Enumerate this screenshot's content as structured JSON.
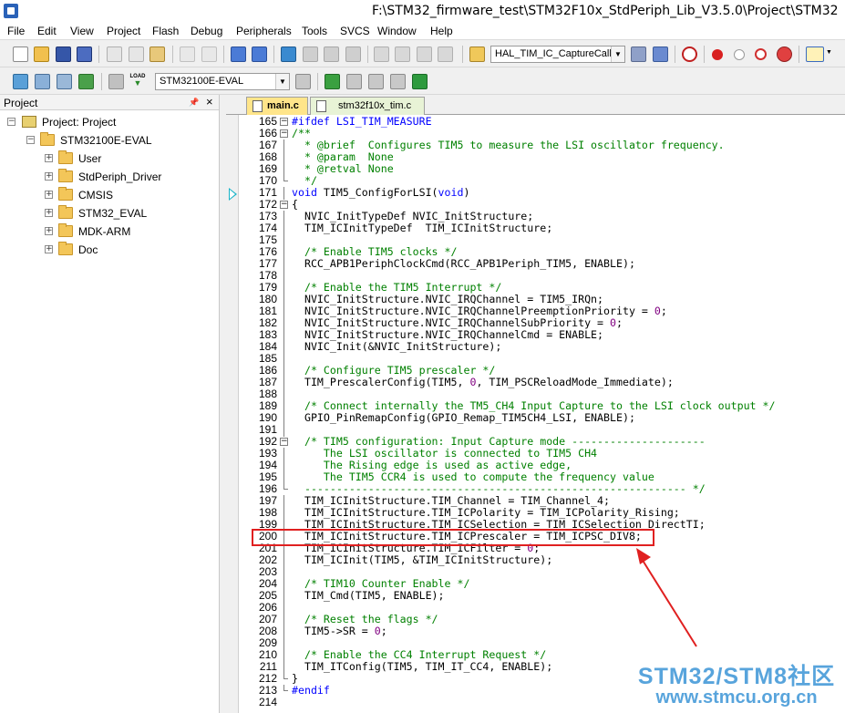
{
  "window": {
    "title": "F:\\STM32_firmware_test\\STM32F10x_StdPeriph_Lib_V3.5.0\\Project\\STM32"
  },
  "menu": [
    "File",
    "Edit",
    "View",
    "Project",
    "Flash",
    "Debug",
    "Peripherals",
    "Tools",
    "SVCS",
    "Window",
    "Help"
  ],
  "toolbar": {
    "function_combo": "HAL_TIM_IC_CaptureCallb",
    "target_combo": "STM32100E-EVAL",
    "load_label": "LOAD"
  },
  "project_panel": {
    "title": "Project",
    "pin_icon": "pin-icon",
    "close_label": "×",
    "root": "Project: Project",
    "target": "STM32100E-EVAL",
    "groups": [
      "User",
      "StdPeriph_Driver",
      "CMSIS",
      "STM32_EVAL",
      "MDK-ARM",
      "Doc"
    ]
  },
  "tabs": [
    {
      "label": "main.c",
      "active": true
    },
    {
      "label": "stm32f10x_tim.c",
      "active": false
    }
  ],
  "highlighted_line": 200,
  "code": [
    {
      "n": "165",
      "t": "#ifdef LSI_TIM_MEASURE",
      "k": "preproc",
      "f": "box"
    },
    {
      "n": "166",
      "t": "/**",
      "k": "comment",
      "f": "box"
    },
    {
      "n": "167",
      "t": "  * @brief  Configures TIM5 to measure the LSI oscillator frequency.",
      "k": "comment",
      "f": "line"
    },
    {
      "n": "168",
      "t": "  * @param  None",
      "k": "comment",
      "f": "line"
    },
    {
      "n": "169",
      "t": "  * @retval None",
      "k": "comment",
      "f": "line"
    },
    {
      "n": "170",
      "t": "  */",
      "k": "comment",
      "f": "end"
    },
    {
      "n": "171",
      "t": "void TIM5_ConfigForLSI(void)",
      "k": "code",
      "f": "line"
    },
    {
      "n": "172",
      "t": "{",
      "k": "code",
      "f": "box"
    },
    {
      "n": "173",
      "t": "  NVIC_InitTypeDef NVIC_InitStructure;",
      "k": "code",
      "f": "line"
    },
    {
      "n": "174",
      "t": "  TIM_ICInitTypeDef  TIM_ICInitStructure;",
      "k": "code",
      "f": "line"
    },
    {
      "n": "175",
      "t": "",
      "k": "code",
      "f": "line"
    },
    {
      "n": "176",
      "t": "  /* Enable TIM5 clocks */",
      "k": "comment",
      "f": "line"
    },
    {
      "n": "177",
      "t": "  RCC_APB1PeriphClockCmd(RCC_APB1Periph_TIM5, ENABLE);",
      "k": "code",
      "f": "line"
    },
    {
      "n": "178",
      "t": "",
      "k": "code",
      "f": "line"
    },
    {
      "n": "179",
      "t": "  /* Enable the TIM5 Interrupt */",
      "k": "comment",
      "f": "line"
    },
    {
      "n": "180",
      "t": "  NVIC_InitStructure.NVIC_IRQChannel = TIM5_IRQn;",
      "k": "code",
      "f": "line"
    },
    {
      "n": "181",
      "t": "  NVIC_InitStructure.NVIC_IRQChannelPreemptionPriority = 0;",
      "k": "code",
      "f": "line"
    },
    {
      "n": "182",
      "t": "  NVIC_InitStructure.NVIC_IRQChannelSubPriority = 0;",
      "k": "code",
      "f": "line"
    },
    {
      "n": "183",
      "t": "  NVIC_InitStructure.NVIC_IRQChannelCmd = ENABLE;",
      "k": "code",
      "f": "line"
    },
    {
      "n": "184",
      "t": "  NVIC_Init(&NVIC_InitStructure);",
      "k": "code",
      "f": "line"
    },
    {
      "n": "185",
      "t": "",
      "k": "code",
      "f": "line"
    },
    {
      "n": "186",
      "t": "  /* Configure TIM5 prescaler */",
      "k": "comment",
      "f": "line"
    },
    {
      "n": "187",
      "t": "  TIM_PrescalerConfig(TIM5, 0, TIM_PSCReloadMode_Immediate);",
      "k": "code",
      "f": "line"
    },
    {
      "n": "188",
      "t": "",
      "k": "code",
      "f": "line"
    },
    {
      "n": "189",
      "t": "  /* Connect internally the TM5_CH4 Input Capture to the LSI clock output */",
      "k": "comment",
      "f": "line"
    },
    {
      "n": "190",
      "t": "  GPIO_PinRemapConfig(GPIO_Remap_TIM5CH4_LSI, ENABLE);",
      "k": "code",
      "f": "line"
    },
    {
      "n": "191",
      "t": "",
      "k": "code",
      "f": "line"
    },
    {
      "n": "192",
      "t": "  /* TIM5 configuration: Input Capture mode ---------------------",
      "k": "comment",
      "f": "box"
    },
    {
      "n": "193",
      "t": "     The LSI oscillator is connected to TIM5 CH4",
      "k": "comment",
      "f": "line"
    },
    {
      "n": "194",
      "t": "     The Rising edge is used as active edge,",
      "k": "comment",
      "f": "line"
    },
    {
      "n": "195",
      "t": "     The TIM5 CCR4 is used to compute the frequency value",
      "k": "comment",
      "f": "line"
    },
    {
      "n": "196",
      "t": "  ------------------------------------------------------------ */",
      "k": "comment",
      "f": "end"
    },
    {
      "n": "197",
      "t": "  TIM_ICInitStructure.TIM_Channel = TIM_Channel_4;",
      "k": "code",
      "f": "line"
    },
    {
      "n": "198",
      "t": "  TIM_ICInitStructure.TIM_ICPolarity = TIM_ICPolarity_Rising;",
      "k": "code",
      "f": "line"
    },
    {
      "n": "199",
      "t": "  TIM_ICInitStructure.TIM_ICSelection = TIM_ICSelection_DirectTI;",
      "k": "code",
      "f": "line"
    },
    {
      "n": "200",
      "t": "  TIM_ICInitStructure.TIM_ICPrescaler = TIM_ICPSC_DIV8;",
      "k": "code",
      "f": "line"
    },
    {
      "n": "201",
      "t": "  TIM_ICInitStructure.TIM_ICFilter = 0;",
      "k": "code",
      "f": "line"
    },
    {
      "n": "202",
      "t": "  TIM_ICInit(TIM5, &TIM_ICInitStructure);",
      "k": "code",
      "f": "line"
    },
    {
      "n": "203",
      "t": "",
      "k": "code",
      "f": "line"
    },
    {
      "n": "204",
      "t": "  /* TIM10 Counter Enable */",
      "k": "comment",
      "f": "line"
    },
    {
      "n": "205",
      "t": "  TIM_Cmd(TIM5, ENABLE);",
      "k": "code",
      "f": "line"
    },
    {
      "n": "206",
      "t": "",
      "k": "code",
      "f": "line"
    },
    {
      "n": "207",
      "t": "  /* Reset the flags */",
      "k": "comment",
      "f": "line"
    },
    {
      "n": "208",
      "t": "  TIM5->SR = 0;",
      "k": "code",
      "f": "line"
    },
    {
      "n": "209",
      "t": "",
      "k": "code",
      "f": "line"
    },
    {
      "n": "210",
      "t": "  /* Enable the CC4 Interrupt Request */",
      "k": "comment",
      "f": "line"
    },
    {
      "n": "211",
      "t": "  TIM_ITConfig(TIM5, TIM_IT_CC4, ENABLE);",
      "k": "code",
      "f": "line"
    },
    {
      "n": "212",
      "t": "}",
      "k": "code",
      "f": "end"
    },
    {
      "n": "213",
      "t": "#endif",
      "k": "preproc",
      "f": "end"
    },
    {
      "n": "214",
      "t": "",
      "k": "code",
      "f": "none"
    }
  ],
  "watermark": {
    "line1": "STM32/STM8社区",
    "line2": "www.stmcu.org.cn"
  },
  "colors": {
    "comment": "#008000",
    "keyword": "#0000ff",
    "number": "#800080",
    "annotation": "#e02020",
    "active_tab": "#ffe58a",
    "watermark": "#3c95d6"
  }
}
